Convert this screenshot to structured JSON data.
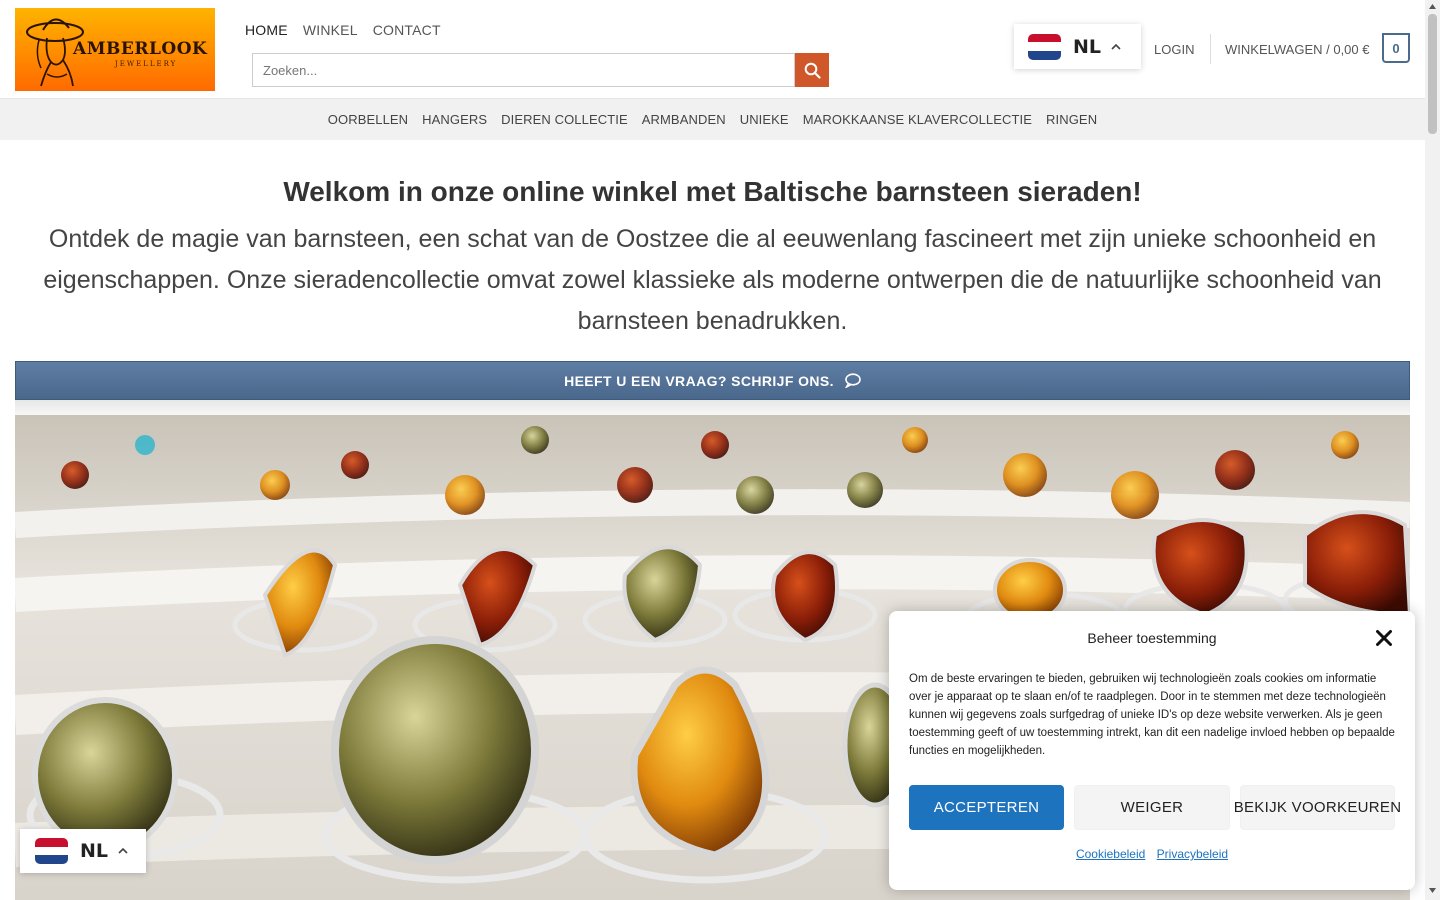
{
  "header": {
    "logo": {
      "brand": "AMBERLOOK",
      "sub": "JEWELLERY"
    },
    "nav": [
      {
        "label": "HOME"
      },
      {
        "label": "WINKEL"
      },
      {
        "label": "CONTACT"
      }
    ],
    "search": {
      "placeholder": "Zoeken..."
    },
    "language": {
      "code": "NL"
    },
    "login": "LOGIN",
    "cart": {
      "label": "WINKELWAGEN / 0,00 €",
      "count": "0"
    }
  },
  "categories": [
    "OORBELLEN",
    "HANGERS",
    "DIEREN COLLECTIE",
    "ARMBANDEN",
    "UNIEKE",
    "MAROKKAANSE KLAVERCOLLECTIE",
    "RINGEN"
  ],
  "hero": {
    "title": "Welkom in onze online winkel met Baltische barnsteen sieraden!",
    "text": "Ontdek de magie van barnsteen, een schat van de Oostzee die al eeuwenlang fascineert met zijn unieke schoonheid en eigenschappen. Onze sieradencollectie omvat zowel klassieke als moderne ontwerpen die de natuurlijke schoonheid van barnsteen benadrukken."
  },
  "question_bar": {
    "label": "HEEFT U EEN VRAAG? SCHRIJF ONS."
  },
  "cookie": {
    "title": "Beheer toestemming",
    "body": "Om de beste ervaringen te bieden, gebruiken wij technologieën zoals cookies om informatie over je apparaat op te slaan en/of te raadplegen. Door in te stemmen met deze technologieën kunnen wij gegevens zoals surfgedrag of unieke ID's op deze website verwerken. Als je geen toestemming geeft of uw toestemming intrekt, kan dit een nadelige invloed hebben op bepaalde functies en mogelijkheden.",
    "accept": "ACCEPTEREN",
    "deny": "WEIGER",
    "prefs": "BEKIJK VOORKEUREN",
    "links": [
      "Cookiebeleid",
      "Privacybeleid"
    ]
  },
  "language_bottom": {
    "code": "NL"
  },
  "colors": {
    "accent_blue": "#1e73be",
    "search_button": "#d0572a",
    "question_bar": "#4a678c",
    "logo_orange": "#ff8c00"
  }
}
